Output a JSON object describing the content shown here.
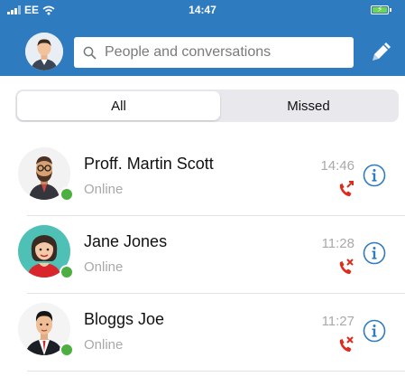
{
  "status_bar": {
    "carrier": "EE",
    "time": "14:47"
  },
  "header": {
    "search_placeholder": "People and conversations",
    "icons": {
      "avatar": "user-avatar",
      "search": "search-icon",
      "compose": "pencil-icon"
    }
  },
  "tabs": [
    {
      "label": "All",
      "selected": true
    },
    {
      "label": "Missed",
      "selected": false
    }
  ],
  "contacts": [
    {
      "name": "Proff. Martin Scott",
      "status": "Online",
      "time": "14:46",
      "call_icon": "outgoing-call-icon",
      "avatar": "bearded-man-glasses"
    },
    {
      "name": "Jane Jones",
      "status": "Online",
      "time": "11:28",
      "call_icon": "missed-call-icon",
      "avatar": "woman-teal-background"
    },
    {
      "name": "Bloggs Joe",
      "status": "Online",
      "time": "11:27",
      "call_icon": "missed-call-icon",
      "avatar": "man-suit-red-tie"
    }
  ],
  "colors": {
    "header_blue": "#2f7bc0",
    "presence_green": "#4caf3f",
    "call_red": "#e02a1c",
    "info_blue": "#2f7bc0"
  }
}
